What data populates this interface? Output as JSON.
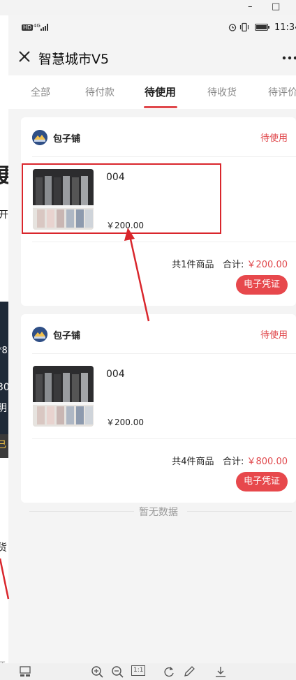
{
  "window": {
    "minimize_glyph": "–",
    "maximize_glyph": "□"
  },
  "status_bar": {
    "hd_badge": "HD",
    "network": "4G",
    "time": "11:34"
  },
  "background_page": {
    "fragments": [
      "更",
      "开",
      "*8",
      "30",
      "明",
      "已",
      "货",
      "还"
    ]
  },
  "nav": {
    "close_icon": "close-icon",
    "title": "智慧城市V5",
    "more_icon": "more-icon"
  },
  "tabs": [
    {
      "label": "全部",
      "active": false
    },
    {
      "label": "待付款",
      "active": false
    },
    {
      "label": "待使用",
      "active": true
    },
    {
      "label": "待收货",
      "active": false
    },
    {
      "label": "待评价",
      "active": false
    }
  ],
  "orders": [
    {
      "shop_name": "包子铺",
      "status": "待使用",
      "product_name": "004",
      "product_price": "￥200.00",
      "summary_count": "共1件商品",
      "summary_total_label": "合计:",
      "summary_total": "￥200.00",
      "voucher_label": "电子凭证"
    },
    {
      "shop_name": "包子铺",
      "status": "待使用",
      "product_name": "004",
      "product_price": "￥200.00",
      "summary_count": "共4件商品",
      "summary_total_label": "合计:",
      "summary_total": "￥800.00",
      "voucher_label": "电子凭证"
    }
  ],
  "no_data_text": "暂无数据",
  "bottom_toolbar": {
    "tools": [
      "thumbnail-icon",
      "zoom-in-icon",
      "zoom-out-icon",
      "actual-size-icon",
      "rotate-icon",
      "edit-icon",
      "download-icon"
    ],
    "actual_size_label": "1:1"
  },
  "colors": {
    "accent": "#e0484c",
    "annotation": "#d9262c"
  }
}
